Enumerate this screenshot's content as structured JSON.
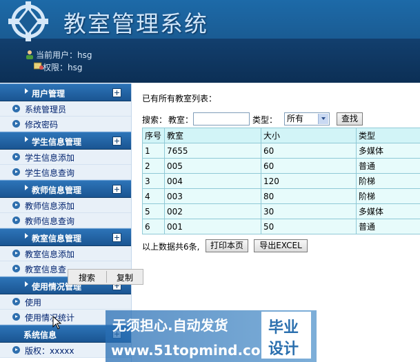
{
  "header": {
    "title": "教室管理系统",
    "current_user_label": "当前用户：",
    "current_user": "hsg",
    "permission_label": "权限：",
    "permission": "hsg"
  },
  "sidebar": {
    "groups": [
      {
        "label": "用户管理",
        "items": [
          "系统管理员",
          "修改密码"
        ]
      },
      {
        "label": "学生信息管理",
        "items": [
          "学生信息添加",
          "学生信息查询"
        ]
      },
      {
        "label": "教师信息管理",
        "items": [
          "教师信息添加",
          "教师信息查询"
        ]
      },
      {
        "label": "教室信息管理",
        "items": [
          "教室信息添加",
          "教室信息查"
        ]
      },
      {
        "label": "使用情况管理",
        "items": [
          "使用",
          "使用情况统计"
        ]
      },
      {
        "label": "系统信息",
        "items": [
          "版权：xxxxx"
        ]
      }
    ]
  },
  "main": {
    "list_title": "已有所有教室列表：",
    "search": {
      "label": "搜索：",
      "room_label": "教室：",
      "room_value": "",
      "type_label": "类型：",
      "type_selected": "所有",
      "button": "查找"
    },
    "table": {
      "headers": [
        "序号",
        "教室",
        "大小",
        "类型"
      ],
      "rows": [
        [
          "1",
          "7655",
          "60",
          "多媒体"
        ],
        [
          "2",
          "005",
          "60",
          "普通"
        ],
        [
          "3",
          "004",
          "120",
          "阶梯"
        ],
        [
          "4",
          "003",
          "80",
          "阶梯"
        ],
        [
          "5",
          "002",
          "30",
          "多媒体"
        ],
        [
          "6",
          "001",
          "50",
          "普通"
        ]
      ]
    },
    "summary_text": "以上数据共6条,",
    "print_button": "打印本页",
    "export_button": "导出EXCEL"
  },
  "context_menu": {
    "search": "搜索",
    "copy": "复制"
  },
  "watermark": {
    "line1": "无须担心.自动发货",
    "line2": "www.51topmind.com",
    "box_line1": "毕业",
    "box_line2": "设计"
  },
  "colors": {
    "header_blue": "#1a5c94",
    "sidebar_head": "#1a5592",
    "table_bg": "#e7fbfb",
    "table_border": "#8fc9d6"
  }
}
